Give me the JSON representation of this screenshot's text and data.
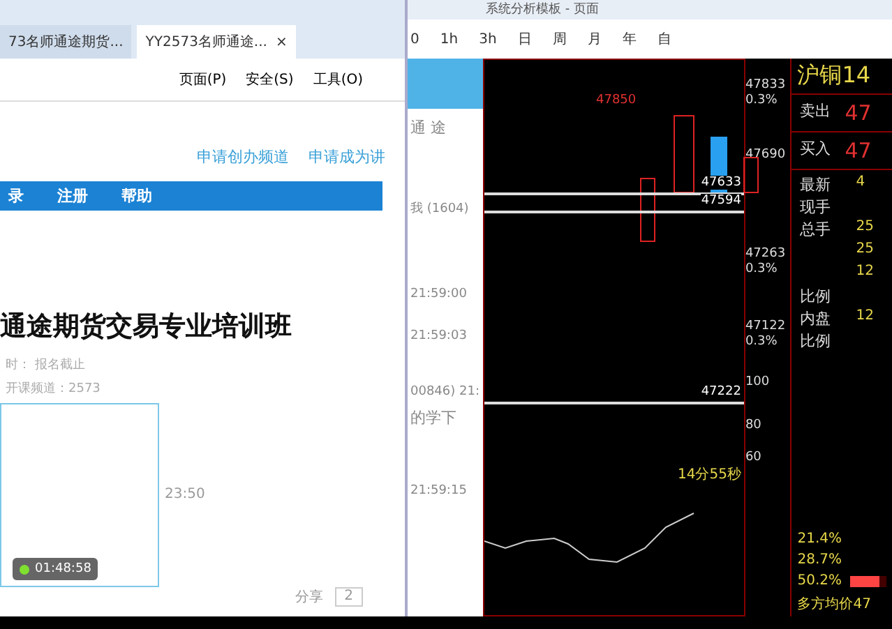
{
  "browser": {
    "tabs": [
      {
        "label": "73名师通途期货...",
        "selected": false
      },
      {
        "label": "YY2573名师通途...",
        "selected": true,
        "close": "×"
      }
    ],
    "command_bar": [
      "页面(P)",
      "安全(S)",
      "工具(O)"
    ],
    "links": [
      "申请创办频道",
      "申请成为讲"
    ],
    "nav": [
      "录",
      "注册",
      "帮助"
    ],
    "course_title": "通途期货交易专业培训班",
    "course_meta": [
      "时：  报名截止",
      "开课频道：2573"
    ],
    "time": "23:50",
    "timer": "01:48:58",
    "share": "分享",
    "share_count": "2"
  },
  "chat": {
    "header": "通 途",
    "entries": [
      {
        "text": "我",
        "count": "(1604)"
      },
      {
        "text": "21:59:00"
      },
      {
        "text": "21:59:03"
      },
      {
        "text": "00846) 21:"
      },
      {
        "text": "的学下"
      },
      {
        "text": "21:59:15"
      }
    ]
  },
  "trading": {
    "title": "系统分析模板 - 页面",
    "periods": [
      {
        "label": "0",
        "selected": false
      },
      {
        "label": "1h",
        "selected": false
      },
      {
        "label": "3h",
        "selected": false
      },
      {
        "label": "日",
        "selected": false
      },
      {
        "label": "周",
        "selected": false
      },
      {
        "label": "月",
        "selected": false
      },
      {
        "label": "年",
        "selected": false
      },
      {
        "label": "自",
        "selected": false
      }
    ],
    "high_label": "47850",
    "price_lines": [
      "47633",
      "47594",
      "47222"
    ],
    "countdown": "14分55秒",
    "axis": [
      {
        "value": "47833",
        "pct": "0.3%"
      },
      {
        "value": "47690"
      },
      {
        "value": "47263",
        "pct": "0.3%"
      },
      {
        "value": "47122",
        "pct": "0.3%"
      },
      {
        "value": "100"
      },
      {
        "value": "80"
      },
      {
        "value": "60"
      }
    ],
    "quote": {
      "symbol": "沪铜14",
      "bid_ask": [
        {
          "label": "卖出",
          "value": "47"
        },
        {
          "label": "买入",
          "value": "47"
        }
      ],
      "rows": [
        {
          "label": "最新",
          "value": "4"
        },
        {
          "label": "现手"
        },
        {
          "label": "总手",
          "value": "25"
        },
        {
          "value": "25"
        },
        {
          "value": "12"
        },
        {
          "label": "比例"
        },
        {
          "label": "内盘",
          "value": "12"
        },
        {
          "label": "比例"
        }
      ],
      "ratios": [
        {
          "pct": "21.4%"
        },
        {
          "pct": "28.7%"
        },
        {
          "pct": "50.2%",
          "level": 0.8
        }
      ],
      "avg": "多方均价47"
    }
  }
}
